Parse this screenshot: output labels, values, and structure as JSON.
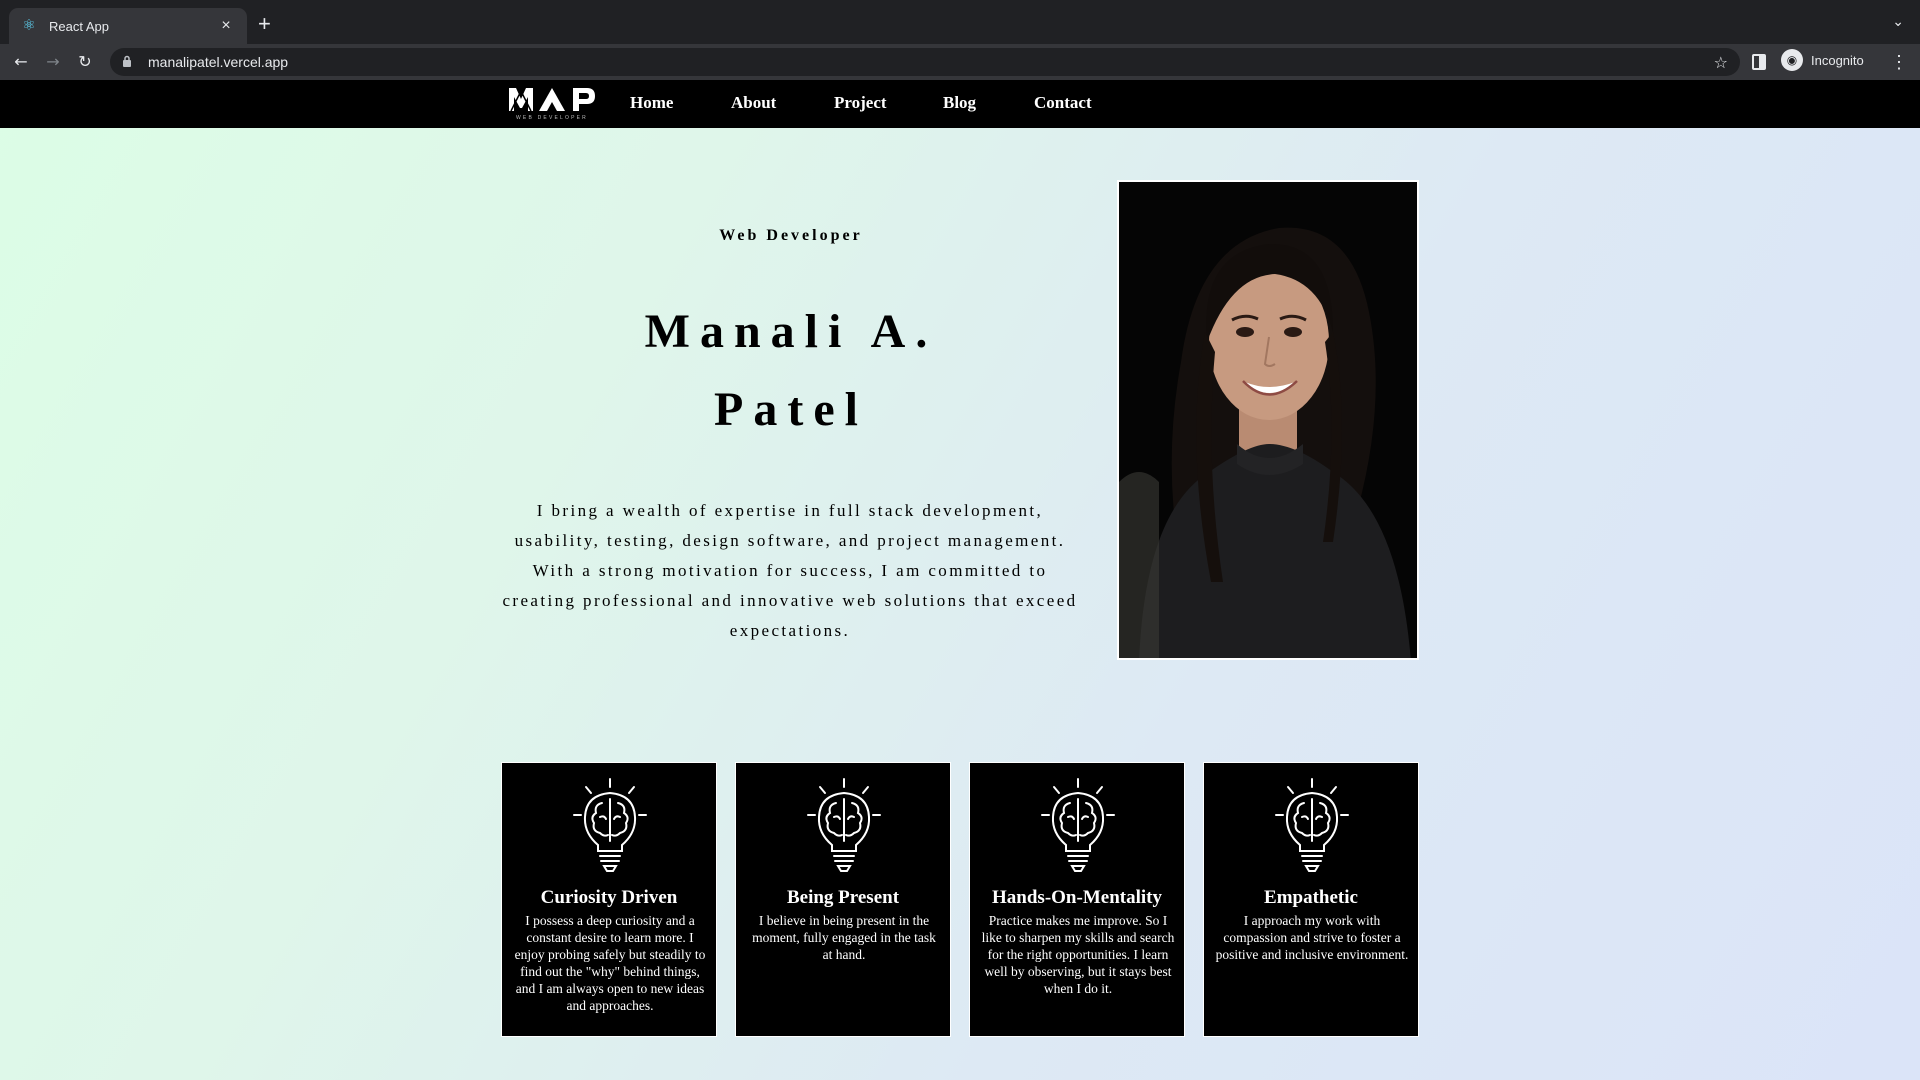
{
  "browser": {
    "tab_title": "React App",
    "tab_close": "×",
    "new_tab": "+",
    "url": "manalipatel.vercel.app",
    "profile_label": "Incognito"
  },
  "site": {
    "logo_text": "MAP",
    "logo_subtext": "WEB DEVELOPER",
    "nav": [
      "Home",
      "About",
      "Project",
      "Blog",
      "Contact"
    ]
  },
  "hero": {
    "subtitle": "Web Developer",
    "name_line1": "Manali A.",
    "name_line2": "Patel",
    "bio": "I bring a wealth of expertise in full stack development, usability, testing, design software, and project management. With a strong motivation for success, I am committed to creating professional and innovative web solutions that exceed expectations.",
    "portrait_icon": "person-photo"
  },
  "cards": [
    {
      "icon": "brain-lightbulb-icon",
      "title": "Curiosity Driven",
      "text": "I possess a deep curiosity and a constant desire to learn more. I enjoy probing safely but steadily to find out the \"why\" behind things, and I am always open to new ideas and approaches."
    },
    {
      "icon": "brain-lightbulb-icon",
      "title": "Being Present",
      "text": "I believe in being present in the moment, fully engaged in the task at hand."
    },
    {
      "icon": "brain-lightbulb-icon",
      "title": "Hands-On-Mentality",
      "text": "Practice makes me improve. So I like to sharpen my skills and search for the right opportunities. I learn well by observing, but it stays best when I do it."
    },
    {
      "icon": "brain-lightbulb-icon",
      "title": "Empathetic",
      "text": "I approach my work with compassion and strive to foster a positive and inclusive environment."
    }
  ],
  "colors": {
    "nav_bg": "#000000",
    "card_bg": "#000000",
    "gradient_start": "#dcfde6",
    "gradient_end": "#dbe4f8"
  }
}
